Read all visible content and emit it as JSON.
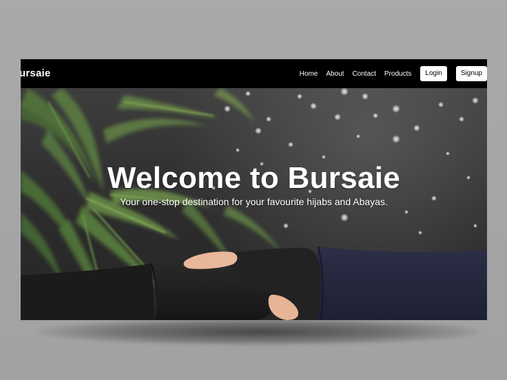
{
  "navbar": {
    "brand": "ursaie",
    "links": [
      "Home",
      "About",
      "Contact",
      "Products"
    ],
    "login_label": "Login",
    "signup_label": "Signup"
  },
  "hero": {
    "title": "Welcome to Bursaie",
    "subtitle": "Your one-stop destination for your favourite hijabs and Abayas."
  },
  "colors": {
    "navbar_bg": "#000000",
    "nav_text": "#ffffff",
    "button_bg": "#ffffff",
    "button_text": "#000000",
    "hero_text": "#ffffff"
  }
}
